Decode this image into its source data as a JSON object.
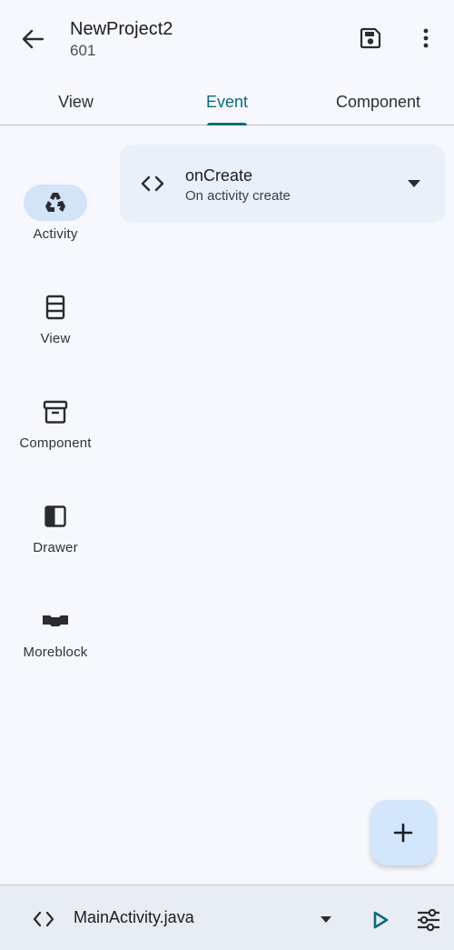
{
  "appbar": {
    "title": "NewProject2",
    "subtitle": "601",
    "back_icon": "arrow-back-icon",
    "save_icon": "save-icon",
    "more_icon": "more-vert-icon"
  },
  "tabs": [
    {
      "label": "View"
    },
    {
      "label": "Event"
    },
    {
      "label": "Component"
    }
  ],
  "active_tab": "Event",
  "rail": {
    "items": [
      {
        "label": "Activity",
        "icon": "recycle-icon",
        "active": true
      },
      {
        "label": "View",
        "icon": "view-list-icon",
        "active": false
      },
      {
        "label": "Component",
        "icon": "archive-icon",
        "active": false
      },
      {
        "label": "Drawer",
        "icon": "drawer-icon",
        "active": false
      },
      {
        "label": "Moreblock",
        "icon": "block-icon",
        "active": false
      }
    ]
  },
  "event": {
    "name": "onCreate",
    "description": "On activity create",
    "icon": "code-icon"
  },
  "fab": {
    "icon": "add-icon"
  },
  "bottombar": {
    "file": "MainActivity.java",
    "code_icon": "code-icon",
    "run_icon": "play-icon",
    "tune_icon": "tune-icon"
  },
  "colors": {
    "accent": "#0e6c79",
    "background": "#f6f8fd",
    "rail_active_pill": "#d3e3f8",
    "card": "#e9f0f9",
    "fab": "#d3e6fb",
    "bottombar": "#e8ecf3"
  }
}
